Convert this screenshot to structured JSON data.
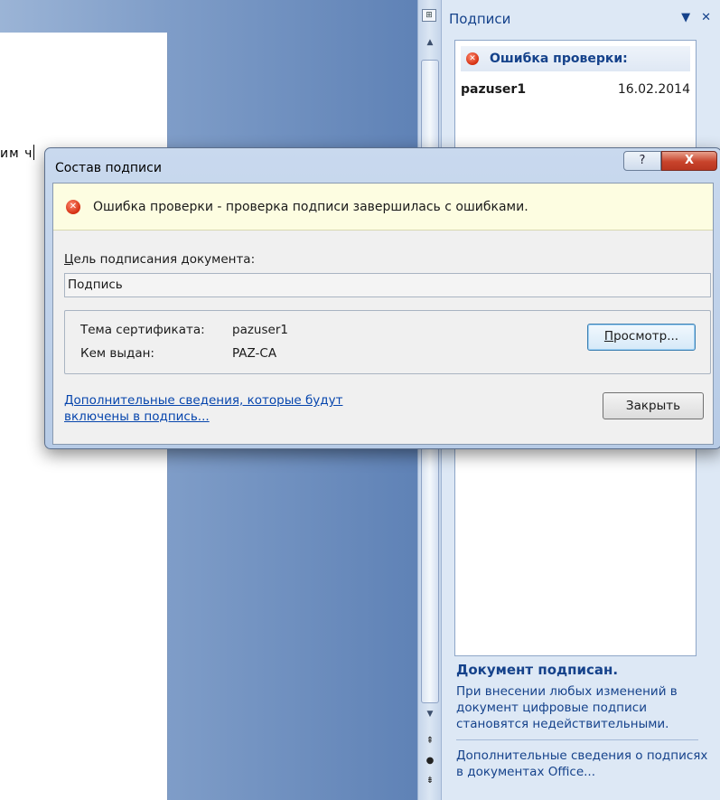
{
  "document": {
    "visible_text": "им ч"
  },
  "pane": {
    "title": "Подписи",
    "menu_glyph": "▼",
    "close_glyph": "✕",
    "error_label": "Ошибка проверки:",
    "signatures": [
      {
        "user": "pazuser1",
        "date": "16.02.2014"
      }
    ],
    "info_title": "Документ подписан.",
    "info_text": "При внесении любых изменений в документ цифровые подписи становятся недействительными.",
    "info_link": "Дополнительные сведения о подписях в документах Office..."
  },
  "scrollbar": {
    "up_glyph": "▲",
    "down_glyph": "▼",
    "prev_glyph": "⇞",
    "select_glyph": "●",
    "next_glyph": "⇟"
  },
  "dialog": {
    "title": "Состав подписи",
    "help_glyph": "?",
    "close_glyph": "X",
    "error_message": "Ошибка проверки - проверка подписи завершилась с ошибками.",
    "purpose_label_first": "Ц",
    "purpose_label_rest": "ель подписания документа:",
    "purpose_value": "Подпись",
    "cert_subject_label": "Тема сертификата:",
    "cert_subject_value": "pazuser1",
    "issued_by_label": "Кем выдан:",
    "issued_by_value": "PAZ-CA",
    "view_button_first": "П",
    "view_button_rest": "росмотр...",
    "more_info_link": "Дополнительные сведения, которые будут включены в подпись...",
    "close_button": "Закрыть"
  }
}
